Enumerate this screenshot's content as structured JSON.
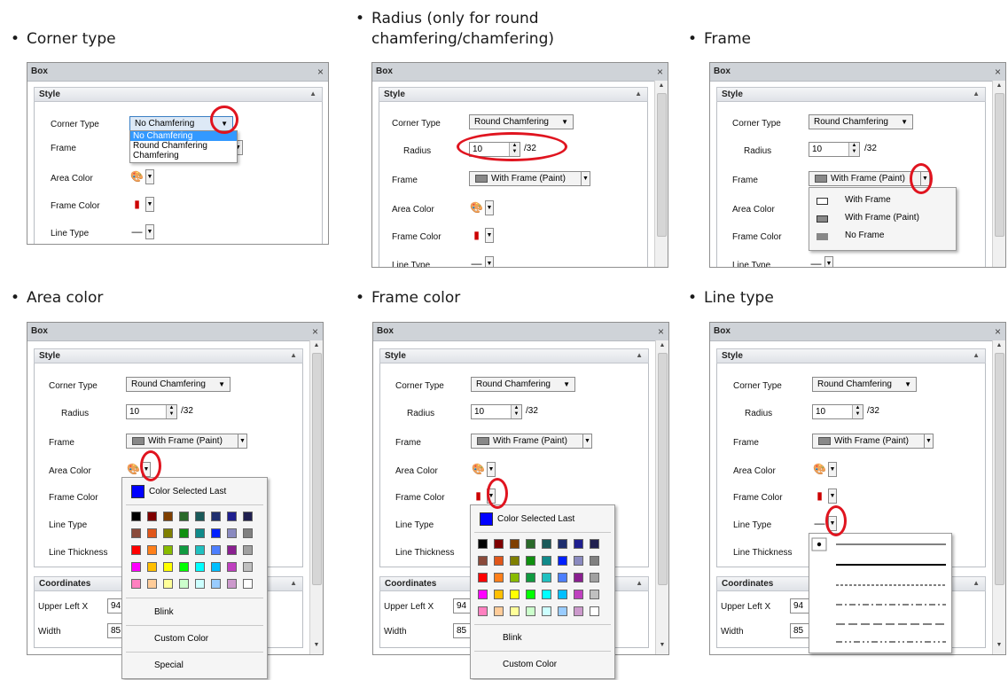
{
  "captions": {
    "c1": "Corner type",
    "c2_l1": "Radius (only for round",
    "c2_l2": "chamfering/chamfering)",
    "c3": "Frame",
    "c4": "Area color",
    "c5": "Frame color",
    "c6": "Line type"
  },
  "bullet": "•",
  "panel": {
    "title": "Box",
    "close": "×",
    "style_header": "Style",
    "coord_header": "Coordinates",
    "labels": {
      "corner_type": "Corner Type",
      "radius": "Radius",
      "frame": "Frame",
      "area_color": "Area Color",
      "frame_color": "Frame Color",
      "line_type": "Line Type",
      "line_thickness": "Line Thickness",
      "upper_left_x": "Upper Left X",
      "width": "Width"
    },
    "values": {
      "corner_no": "No Chamfering",
      "corner_round": "Round Chamfering",
      "radius": "10",
      "radius_max": "/32",
      "frame_paint": "With Frame (Paint)",
      "upper_left_x": "94",
      "width": "85"
    }
  },
  "corner_options": [
    "No Chamfering",
    "Round Chamfering",
    "Chamfering"
  ],
  "frame_options": [
    "With Frame",
    "With Frame (Paint)",
    "No Frame"
  ],
  "color_menu": {
    "last": "Color Selected Last",
    "blink": "Blink",
    "custom": "Custom Color",
    "special": "Special"
  },
  "palette": [
    [
      "#000000",
      "#7f0000",
      "#7f3f00",
      "#2a6a2a",
      "#1a5a5a",
      "#1f2f6f",
      "#1f1f8f",
      "#202050"
    ],
    [
      "#8a4a3a",
      "#e0561a",
      "#7f7f00",
      "#109010",
      "#108a8a",
      "#0020ff",
      "#8a8ac0",
      "#808080"
    ],
    [
      "#ff0000",
      "#ff7f1a",
      "#88bb00",
      "#109a40",
      "#20c0c0",
      "#4d7fff",
      "#8a2090",
      "#a0a0a0"
    ],
    [
      "#ff00ff",
      "#ffbf00",
      "#ffff00",
      "#00ff00",
      "#00ffff",
      "#00bfff",
      "#bf40bf",
      "#c0c0c0"
    ],
    [
      "#ff80c0",
      "#ffcc99",
      "#ffff99",
      "#ccffcc",
      "#ccffff",
      "#99ccff",
      "#cc99cc",
      "#ffffff"
    ]
  ],
  "colors": {
    "accent_ring": "#e0141f",
    "selection": "#3399ff",
    "color_last": "#0000ff"
  }
}
